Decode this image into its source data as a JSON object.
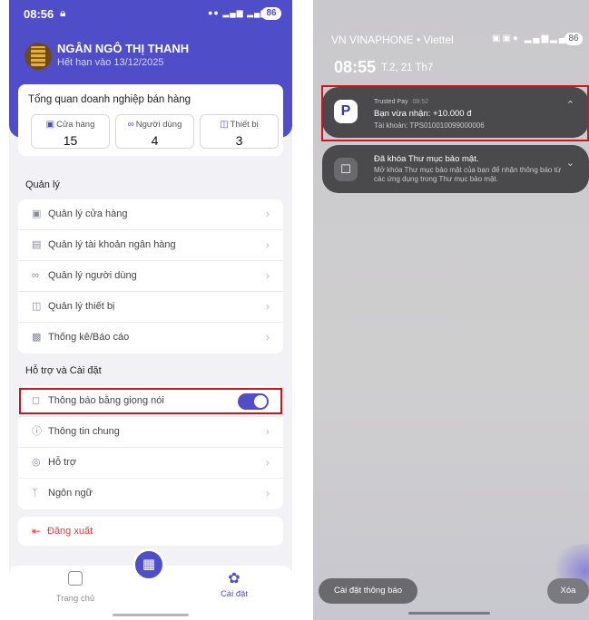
{
  "left_screen": {
    "status_bar": {
      "time": "08:56",
      "battery": "86"
    },
    "user": {
      "name": "NGÂN NGÔ THỊ THANH",
      "expiry": "Hết hạn vào 13/12/2025"
    },
    "overview": {
      "title": "Tổng quan doanh nghiệp bán hàng",
      "stats": [
        {
          "label": "Cửa hàng",
          "value": "15",
          "icon": "store-icon"
        },
        {
          "label": "Người dùng",
          "value": "4",
          "icon": "users-icon"
        },
        {
          "label": "Thiết bị",
          "value": "3",
          "icon": "device-icon"
        }
      ]
    },
    "management": {
      "title": "Quản lý",
      "items": [
        {
          "label": "Quản lý cửa hàng",
          "icon": "store-icon"
        },
        {
          "label": "Quản lý tài khoản ngân hàng",
          "icon": "bank-card-icon"
        },
        {
          "label": "Quản lý người dùng",
          "icon": "users-icon"
        },
        {
          "label": "Quản lý thiết bị",
          "icon": "device-icon"
        },
        {
          "label": "Thống kê/Báo cáo",
          "icon": "chart-icon"
        }
      ]
    },
    "support": {
      "title": "Hỗ trợ và Cài đặt",
      "items": [
        {
          "label": "Thông báo bằng giọng nói",
          "icon": "bell-icon",
          "toggle_on": true
        },
        {
          "label": "Thông tin chung",
          "icon": "info-icon"
        },
        {
          "label": "Hỗ trợ",
          "icon": "support-icon"
        },
        {
          "label": "Ngôn ngữ",
          "icon": "language-icon"
        }
      ]
    },
    "logout": {
      "label": "Đăng xuất"
    },
    "bottom_nav": {
      "home": "Trang chủ",
      "settings": "Cài đặt"
    },
    "accent_color": "#4f4ec8"
  },
  "right_screen": {
    "carrier": "VN VINAPHONE • Viettel",
    "battery": "86",
    "time": "08:55",
    "date": "T.2, 21 Th7",
    "notifications": [
      {
        "app": "Trusted Pay",
        "time": "08:52",
        "title": "Bạn vừa nhận: +10.000 đ",
        "body": "Tài khoản: TPS010010099000006"
      },
      {
        "title": "Đã khóa Thư mục bảo mật.",
        "body": "Mở khóa Thư mục bảo mật của bạn để nhận thông báo từ các ứng dụng trong Thư mục bảo mật."
      }
    ],
    "footer": {
      "settings": "Cài đặt thông báo",
      "clear": "Xóa"
    }
  }
}
